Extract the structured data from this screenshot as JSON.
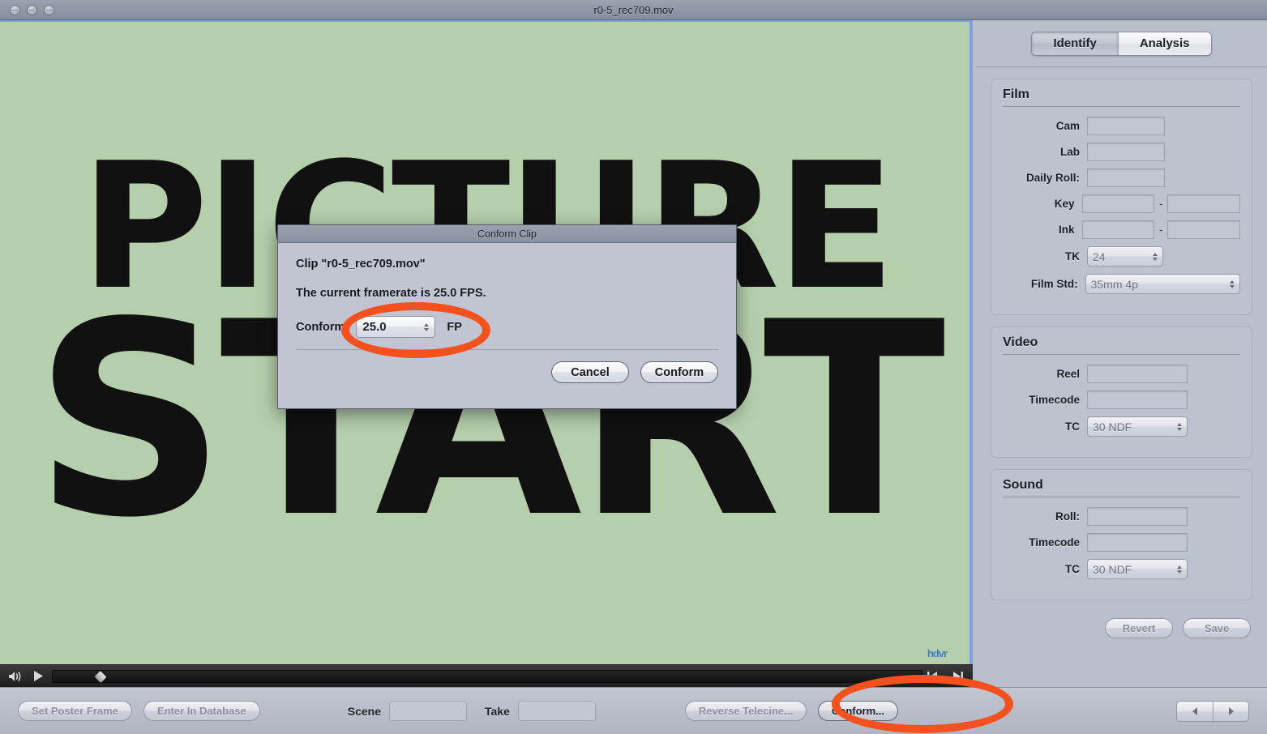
{
  "window": {
    "title": "r0-5_rec709.mov",
    "controls": [
      "close-button",
      "minimize-button",
      "zoom-button"
    ]
  },
  "video": {
    "slate_line1": "PICTURE",
    "slate_line2": "START",
    "background_color": "#b5cfac",
    "watermark": "hdvr"
  },
  "transport": {
    "volume_icon": "speaker-icon",
    "play_icon": "play-icon",
    "playhead": "playhead-marker",
    "step_back_icon": "step-backward-icon",
    "step_forward_icon": "step-forward-icon"
  },
  "bottom_toolbar": {
    "set_poster_frame": "Set Poster Frame",
    "enter_in_database": "Enter In Database",
    "scene_label": "Scene",
    "scene_value": "",
    "take_label": "Take",
    "take_value": "",
    "reverse_telecine": "Reverse Telecine...",
    "conform": "Conform...",
    "prev_icon": "previous-arrow-icon",
    "next_icon": "next-arrow-icon"
  },
  "sidebar": {
    "tabs": [
      {
        "label": "Identify",
        "active": true
      },
      {
        "label": "Analysis",
        "active": false
      }
    ],
    "film": {
      "heading": "Film",
      "cam_label": "Cam",
      "cam_value": "",
      "lab_label": "Lab",
      "lab_value": "",
      "daily_roll_label": "Daily Roll:",
      "daily_roll_value": "",
      "key_label": "Key",
      "key_value_1": "",
      "key_value_2": "",
      "key_separator": "-",
      "ink_label": "Ink",
      "ink_value_1": "",
      "ink_value_2": "",
      "ink_separator": "-",
      "tk_label": "TK",
      "tk_value": "24",
      "film_std_label": "Film Std:",
      "film_std_value": "35mm 4p"
    },
    "video": {
      "heading": "Video",
      "reel_label": "Reel",
      "reel_value": "",
      "timecode_label": "Timecode",
      "timecode_value": "",
      "tc_label": "TC",
      "tc_value": "30 NDF"
    },
    "sound": {
      "heading": "Sound",
      "roll_label": "Roll:",
      "roll_value": "",
      "timecode_label": "Timecode",
      "timecode_value": "",
      "tc_label": "TC",
      "tc_value": "30 NDF"
    },
    "actions": {
      "revert": "Revert",
      "save": "Save"
    }
  },
  "dialog": {
    "title": "Conform Clip",
    "clip_line": "Clip  \"r0-5_rec709.mov\"",
    "framerate_line": "The current framerate is 25.0 FPS.",
    "conform_label": "Conform",
    "conform_value": "25.0",
    "units_label": "FP",
    "cancel_button": "Cancel",
    "confirm_button": "Conform"
  },
  "annotations": {
    "color": "#f4511e",
    "highlight_fps_field": "fps-stepper-highlight",
    "highlight_conform_button": "conform-button-highlight"
  }
}
